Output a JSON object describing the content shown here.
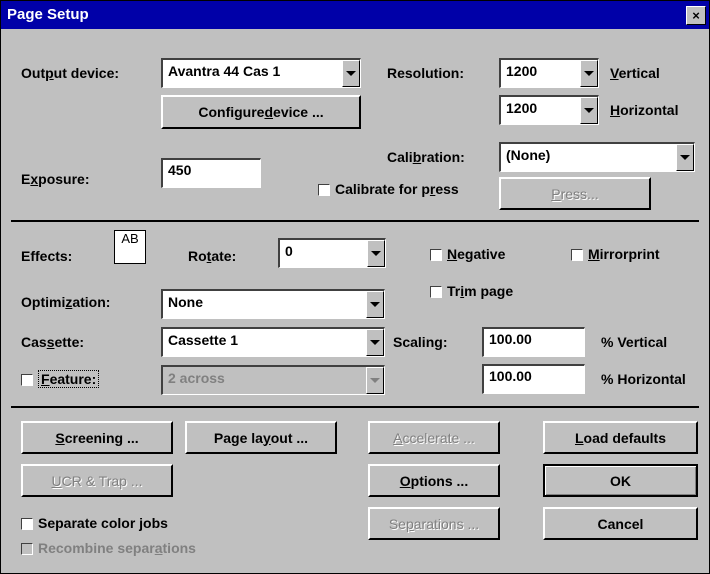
{
  "title": "Page Setup",
  "close": "×",
  "output_device": {
    "label_pre": "Out",
    "label_ul": "p",
    "label_post": "ut device:",
    "value": "Avantra 44 Cas 1"
  },
  "configure": {
    "pre": "Configure ",
    "ul": "d",
    "post": "evice ..."
  },
  "resolution": {
    "label": "Resolution:",
    "vertical_value": "1200",
    "vertical_ul": "V",
    "vertical_rest": "ertical",
    "horizontal_value": "1200",
    "horizontal_ul": "H",
    "horizontal_rest": "orizontal"
  },
  "exposure": {
    "pre": "E",
    "ul": "x",
    "post": "posure:",
    "value": "450"
  },
  "calibration": {
    "pre": "Cali",
    "ul": "b",
    "post": "ration:",
    "value": "(None)"
  },
  "calibrate_press": {
    "pre": "Calibrate for p",
    "ul": "r",
    "post": "ess"
  },
  "press_button": {
    "ul": "P",
    "post": "ress..."
  },
  "effects": {
    "label": "Effects:",
    "preview": "AB"
  },
  "rotate": {
    "pre": "Ro",
    "ul": "t",
    "post": "ate:",
    "value": "0"
  },
  "negative": {
    "ul": "N",
    "post": "egative"
  },
  "mirrorprint": {
    "ul": "M",
    "post": "irrorprint"
  },
  "trim_page": {
    "pre": "Tr",
    "ul": "i",
    "post": "m page"
  },
  "optimization": {
    "pre": "Optimi",
    "ul": "z",
    "post": "ation:",
    "value": "None"
  },
  "cassette": {
    "pre": "Cas",
    "ul": "s",
    "post": "ette:",
    "value": "Cassette 1"
  },
  "scaling": {
    "pre": "Scalin",
    "ul": "g",
    "post": ":",
    "vertical_value": "100.00",
    "vertical_label": "% Vertical",
    "horizontal_value": "100.00",
    "horizontal_label": "% Horizontal"
  },
  "feature": {
    "ul": "F",
    "post": "eature:",
    "value": "2 across"
  },
  "buttons": {
    "screening": {
      "ul": "S",
      "post": "creening ..."
    },
    "page_layout": {
      "pre": "Page la",
      "ul": "y",
      "post": "out ..."
    },
    "accelerate": {
      "ul": "A",
      "post": "ccelerate ..."
    },
    "load_defaults": {
      "ul": "L",
      "post": "oad defaults"
    },
    "ucr_trap": {
      "ul": "U",
      "post": "CR & Trap ..."
    },
    "options": {
      "ul": "O",
      "post": "ptions ..."
    },
    "ok": "OK",
    "separations": {
      "pre": "Se",
      "ul": "p",
      "post": "arations ..."
    },
    "cancel": "Cancel"
  },
  "separate_color_jobs": {
    "pre": "Separate color ",
    "ul": "j",
    "post": "obs"
  },
  "recombine": {
    "pre": "Recombine separ",
    "ul": "a",
    "post": "tions"
  }
}
